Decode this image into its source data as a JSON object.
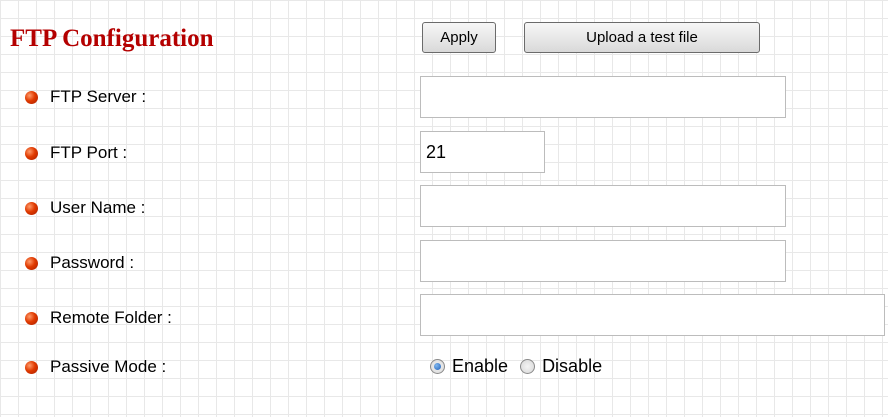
{
  "title": "FTP Configuration",
  "buttons": {
    "apply": "Apply",
    "upload_test": "Upload a test file"
  },
  "fields": [
    {
      "label": "FTP Server :",
      "value": ""
    },
    {
      "label": "FTP Port :",
      "value": "21"
    },
    {
      "label": "User Name :",
      "value": ""
    },
    {
      "label": "Password :",
      "value": ""
    },
    {
      "label": "Remote Folder :",
      "value": ""
    }
  ],
  "passive_mode": {
    "label": "Passive Mode :",
    "options": [
      "Enable",
      "Disable"
    ],
    "selected": "Enable"
  },
  "colors": {
    "title": "#b40000",
    "bullet": "#e03a00",
    "radio_selected": "#1f5fb8"
  }
}
